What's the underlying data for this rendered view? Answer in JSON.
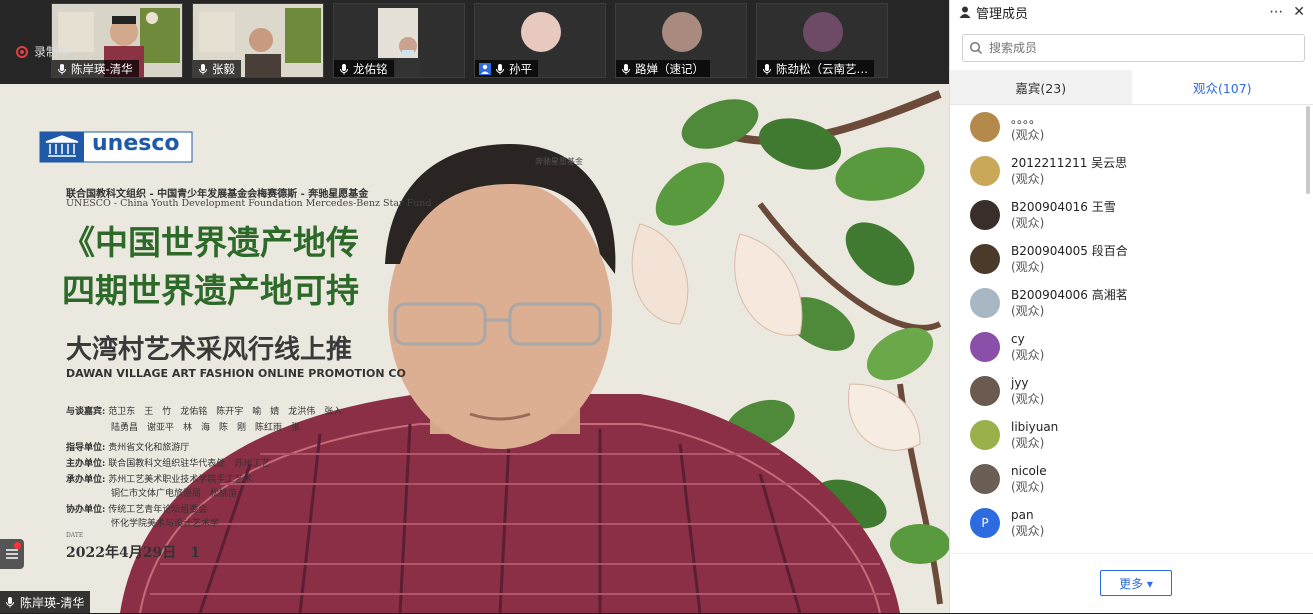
{
  "recording": {
    "label": "录制中"
  },
  "video_tiles": [
    {
      "name": "陈岸瑛-清华",
      "mic": "mic-icon"
    },
    {
      "name": "张毅",
      "mic": "mic-icon"
    },
    {
      "name": "龙佑铭",
      "mic": "mic-icon"
    },
    {
      "name": "孙平",
      "mic": "mic-icon",
      "user_icon": "user-icon"
    },
    {
      "name": "路婵（速记）",
      "mic": "mic-icon"
    },
    {
      "name": "陈劲松（云南艺…",
      "mic": "mic-icon"
    }
  ],
  "main_video": {
    "speaker_label": "陈岸瑛-清华",
    "poster": {
      "logo_text": "unesco",
      "org_cn": "联合国教科文组织 - 中国青少年发展基金会梅赛德斯 - 奔驰星愿基金",
      "org_en": "UNESCO - China Youth Development Foundation Mercedes-Benz Star Fund",
      "title_line1": "《中国世界遗产地传",
      "title_line2": "四期世界遗产地可持",
      "subtitle_cn": "大湾村艺术采风行线上推",
      "subtitle_en": "DAWAN VILLAGE ART FASHION ONLINE PROMOTION CO",
      "guests_label": "与谈嘉宾:",
      "guests_row1": "范卫东　王　竹　龙佑铭　陈开宇　喻　婧　龙洪伟　张入",
      "guests_row2": "陆勇昌　谢亚平　林　海　陈　刚　陈红雨　张",
      "guide_label": "指导单位:",
      "guide_value": "贵州省文化和旅游厅",
      "host_label": "主办单位:",
      "host_value": "联合国教科文组织驻华代表处　苏州工艺",
      "organizer_label": "承办单位:",
      "organizer_value1": "苏州工艺美术职业技术学院手工艺术",
      "organizer_value2": "铜仁市文体广电旅游局　松桃苗",
      "co_label": "协办单位:",
      "co_value1": "传统工艺青年论坛组委会",
      "co_value2": "怀化学院美术与设计艺术学",
      "date_tag": "DATE",
      "date": "2022年4月29日　1",
      "fund_mark": "奔驰星愿基金"
    }
  },
  "panel": {
    "title": "管理成员",
    "search_placeholder": "搜索成员",
    "tabs": {
      "guests": "嘉宾(23)",
      "audience": "观众(107)"
    },
    "members": [
      {
        "name": "。。。。",
        "role": "(观众)",
        "avatar_color": "#b48a4a"
      },
      {
        "name": "2012211211 吴云思",
        "role": "(观众)",
        "avatar_color": "#c9a85a"
      },
      {
        "name": "B200904016 王雪",
        "role": "(观众)",
        "avatar_color": "#3a2e2a"
      },
      {
        "name": "B200904005 段百合",
        "role": "(观众)",
        "avatar_color": "#4a3a2a"
      },
      {
        "name": "B200904006 高湘茗",
        "role": "(观众)",
        "avatar_color": "#a7b7c3"
      },
      {
        "name": "cy",
        "role": "(观众)",
        "avatar_color": "#8a4fa8"
      },
      {
        "name": "jyy",
        "role": "(观众)",
        "avatar_color": "#6b5a50"
      },
      {
        "name": "libiyuan",
        "role": "(观众)",
        "avatar_color": "#9ab04a"
      },
      {
        "name": "nicole",
        "role": "(观众)",
        "avatar_color": "#6a5e55"
      },
      {
        "name": "pan",
        "role": "(观众)",
        "avatar_color": "#2d6be0",
        "avatar_letter": "P"
      }
    ],
    "more_button": "更多 ▾"
  }
}
